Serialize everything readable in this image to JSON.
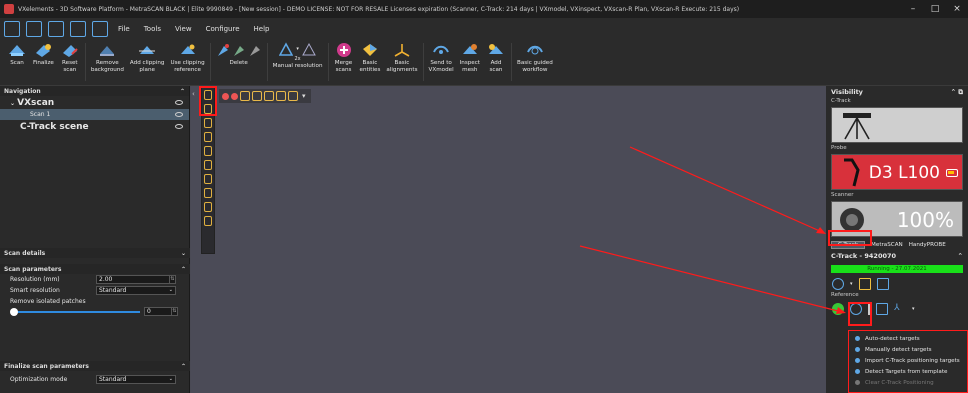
{
  "window": {
    "title": "VXelements - 3D Software Platform - MetraSCAN BLACK | Elite 9990849 - [New session] - DEMO LICENSE: NOT FOR RESALE Licenses expiration (Scanner, C-Track: 214 days | VXmodel, VXinspect, VXscan-R Plan, VXscan-R Execute: 215 days)",
    "min": "–",
    "max": "□",
    "close": "×"
  },
  "menu": [
    "File",
    "Tools",
    "View",
    "Configure",
    "Help"
  ],
  "ribbon": [
    {
      "label": "Scan",
      "icon": "scan-icon"
    },
    {
      "label": "Finalize",
      "icon": "finalize-icon"
    },
    {
      "label": "Reset\nscan",
      "icon": "reset-scan-icon"
    },
    {
      "label": "Remove\nbackground",
      "icon": "remove-background-icon"
    },
    {
      "label": "Add clipping\nplane",
      "icon": "add-clipping-plane-icon"
    },
    {
      "label": "Use clipping\nreference",
      "icon": "use-clipping-reference-icon"
    },
    {
      "label": "Delete",
      "icon": "delete-icon"
    },
    {
      "label": "Manual resolution",
      "icon": "manual-resolution-icon"
    },
    {
      "label": "Merge\nscans",
      "icon": "merge-scans-icon"
    },
    {
      "label": "Basic\nentities",
      "icon": "basic-entities-icon"
    },
    {
      "label": "Basic\nalignments",
      "icon": "basic-alignments-icon"
    },
    {
      "label": "Send to\nVXmodel",
      "icon": "send-to-vxmodel-icon"
    },
    {
      "label": "Inspect\nmesh",
      "icon": "inspect-mesh-icon"
    },
    {
      "label": "Add\nscan",
      "icon": "add-scan-icon"
    },
    {
      "label": "Basic guided\nworkflow",
      "icon": "basic-guided-workflow-icon"
    }
  ],
  "ribbon_resolution_badge": "2x",
  "navigation": {
    "header": "Navigation",
    "vxscan": "VXscan",
    "scan1": "Scan 1",
    "ctrack_scene": "C-Track scene"
  },
  "scan_details": {
    "header": "Scan details"
  },
  "scan_parameters": {
    "header": "Scan parameters",
    "resolution_label": "Resolution (mm)",
    "resolution_value": "2.00",
    "smart_label": "Smart resolution",
    "smart_value": "Standard",
    "remove_label": "Remove isolated patches",
    "remove_value": "0"
  },
  "finalize": {
    "header": "Finalize scan parameters",
    "opt_label": "Optimization mode",
    "opt_value": "Standard"
  },
  "visibility": {
    "header": "Visibility",
    "ctrack_label": "C-Track",
    "probe_label": "Probe",
    "probe_name": "D3 L100",
    "scanner_label": "Scanner",
    "scanner_pct": "100%",
    "tabs": [
      "C-Track",
      "MetraSCAN",
      "HandyPROBE"
    ]
  },
  "ctrack_device": {
    "header": "C-Track - 9420070",
    "status": "Running - 27.07.2021",
    "reference_label": "Reference"
  },
  "ref_menu": [
    {
      "label": "Auto-detect targets",
      "disabled": false
    },
    {
      "label": "Manually detect targets",
      "disabled": false
    },
    {
      "label": "Import C-Track positioning targets",
      "disabled": false
    },
    {
      "label": "Detect Targets from template",
      "disabled": false
    },
    {
      "label": "Clear C-Track Positioning",
      "disabled": true
    }
  ],
  "colors": {
    "accent": "#5fa8e6",
    "highlight": "#ff1b1b",
    "probe": "#d8313b",
    "running": "#19e019"
  }
}
